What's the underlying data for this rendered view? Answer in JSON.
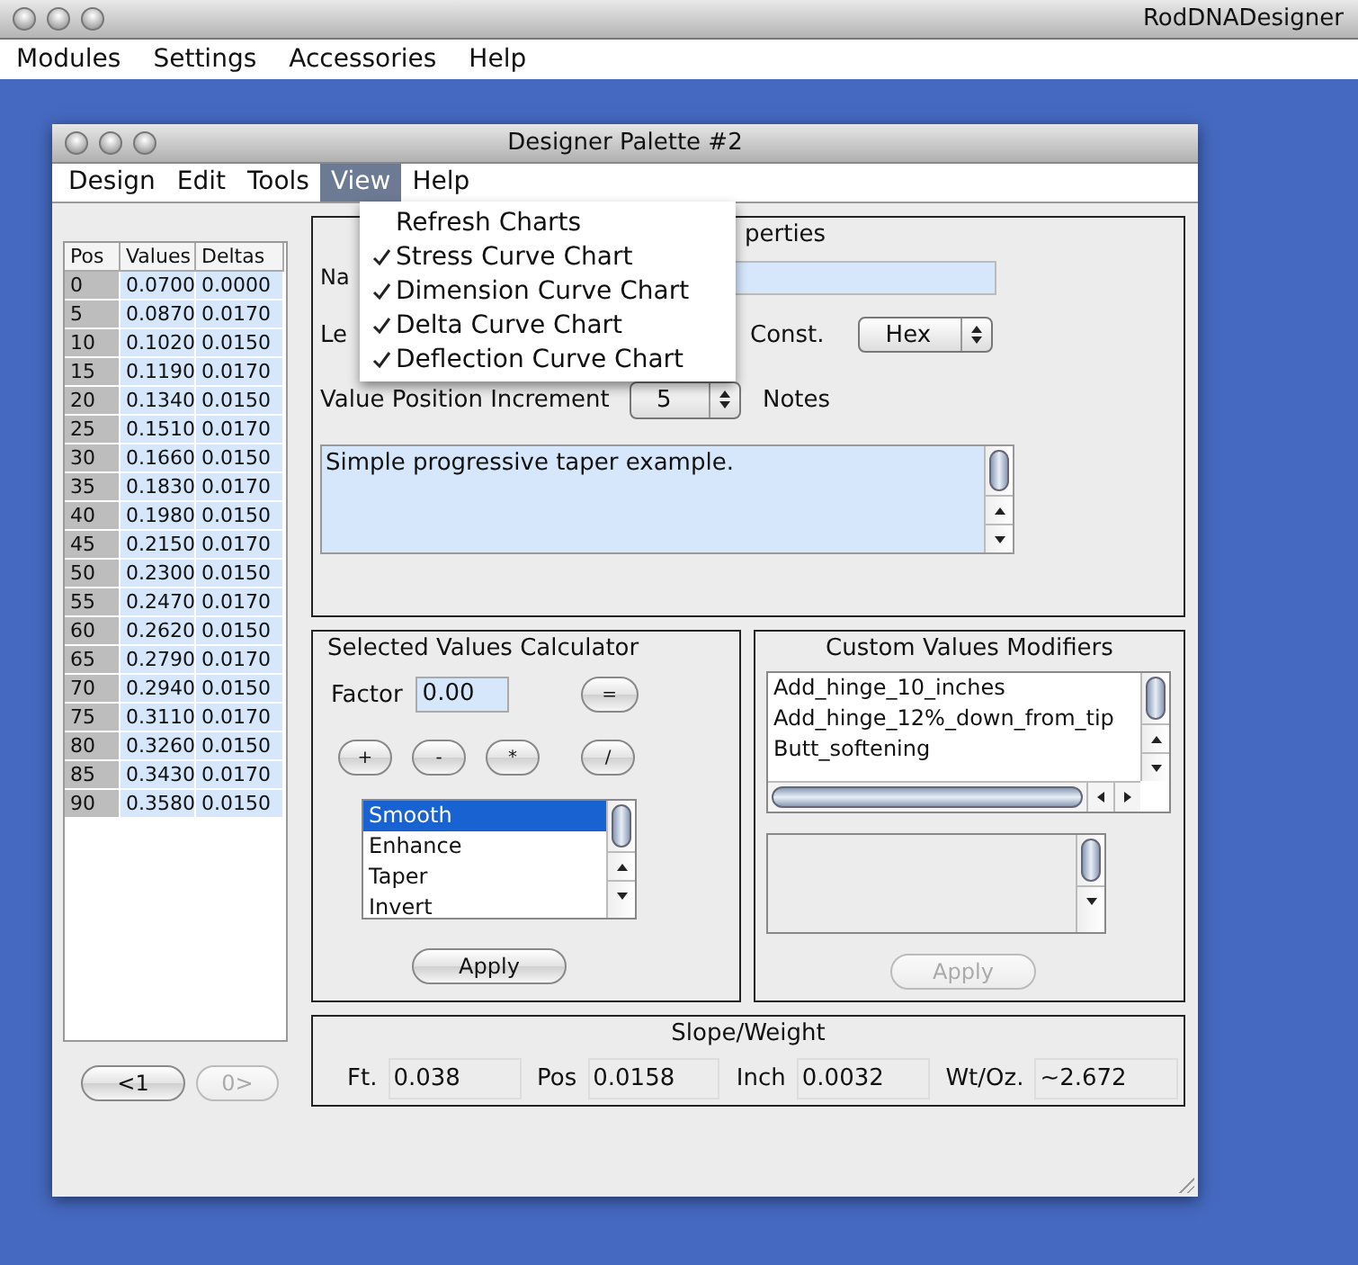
{
  "app": {
    "title": "RodDNADesigner",
    "menus": [
      "Modules",
      "Settings",
      "Accessories",
      "Help"
    ]
  },
  "palette": {
    "title": "Designer Palette #2",
    "menus": [
      {
        "label": "Design",
        "selected": false
      },
      {
        "label": "Edit",
        "selected": false
      },
      {
        "label": "Tools",
        "selected": false
      },
      {
        "label": "View",
        "selected": true
      },
      {
        "label": "Help",
        "selected": false
      }
    ],
    "view_menu": [
      {
        "label": "Refresh Charts",
        "checked": false
      },
      {
        "label": "Stress Curve Chart",
        "checked": true
      },
      {
        "label": "Dimension Curve Chart",
        "checked": true
      },
      {
        "label": "Delta Curve Chart",
        "checked": true
      },
      {
        "label": "Deflection Curve Chart",
        "checked": true
      }
    ]
  },
  "table": {
    "columns": [
      "Pos",
      "Values",
      "Deltas"
    ],
    "rows": [
      [
        "0",
        "0.0700",
        "0.0000"
      ],
      [
        "5",
        "0.0870",
        "0.0170"
      ],
      [
        "10",
        "0.1020",
        "0.0150"
      ],
      [
        "15",
        "0.1190",
        "0.0170"
      ],
      [
        "20",
        "0.1340",
        "0.0150"
      ],
      [
        "25",
        "0.1510",
        "0.0170"
      ],
      [
        "30",
        "0.1660",
        "0.0150"
      ],
      [
        "35",
        "0.1830",
        "0.0170"
      ],
      [
        "40",
        "0.1980",
        "0.0150"
      ],
      [
        "45",
        "0.2150",
        "0.0170"
      ],
      [
        "50",
        "0.2300",
        "0.0150"
      ],
      [
        "55",
        "0.2470",
        "0.0170"
      ],
      [
        "60",
        "0.2620",
        "0.0150"
      ],
      [
        "65",
        "0.2790",
        "0.0170"
      ],
      [
        "70",
        "0.2940",
        "0.0150"
      ],
      [
        "75",
        "0.3110",
        "0.0170"
      ],
      [
        "80",
        "0.3260",
        "0.0150"
      ],
      [
        "85",
        "0.3430",
        "0.0170"
      ],
      [
        "90",
        "0.3580",
        "0.0150"
      ]
    ]
  },
  "pager": [
    {
      "label": "<1",
      "disabled": false
    },
    {
      "label": "0>",
      "disabled": true
    }
  ],
  "design_properties": {
    "legend": "perties",
    "name_label": "Na",
    "length_label": "Le",
    "const_label": "Const.",
    "const_value": "Hex",
    "increment_label": "Value Position Increment",
    "increment_value": "5",
    "notes_label": "Notes",
    "notes": "Simple progressive taper example."
  },
  "calculator": {
    "title": "Selected Values Calculator",
    "factor_label": "Factor",
    "factor_value": "0.00",
    "equals": "=",
    "operators": [
      "+",
      "-",
      "*",
      "/"
    ],
    "options": [
      {
        "label": "Smooth",
        "selected": true
      },
      {
        "label": "Enhance",
        "selected": false
      },
      {
        "label": "Taper",
        "selected": false
      },
      {
        "label": "Invert",
        "selected": false
      }
    ],
    "apply": "Apply"
  },
  "modifiers": {
    "title": "Custom Values Modifiers",
    "items": [
      "Add_hinge_10_inches",
      "Add_hinge_12%_down_from_tip",
      "Butt_softening"
    ],
    "apply": {
      "label": "Apply",
      "disabled": true
    }
  },
  "slope_weight": {
    "title": "Slope/Weight",
    "fields": [
      {
        "label": "Ft.",
        "value": "0.038"
      },
      {
        "label": "Pos",
        "value": "0.0158"
      },
      {
        "label": "Inch",
        "value": "0.0032"
      },
      {
        "label": "Wt/Oz.",
        "value": "~2.672"
      }
    ]
  }
}
